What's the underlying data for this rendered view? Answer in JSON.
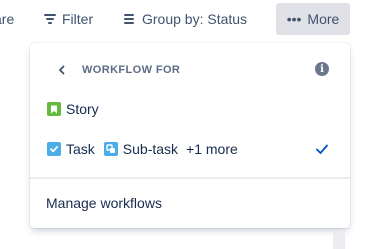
{
  "toolbar": {
    "prev_label": "are",
    "filter_label": "Filter",
    "group_by_label": "Group by: Status",
    "more_label": "More"
  },
  "dropdown": {
    "title": "WORKFLOW FOR",
    "items": [
      {
        "types": [
          "Story"
        ],
        "checked": false
      },
      {
        "types": [
          "Task",
          "Sub-task"
        ],
        "extra": "+1 more",
        "checked": true
      }
    ],
    "manage_label": "Manage workflows"
  },
  "icons": {
    "filter": "filter-icon",
    "group_by": "list-icon",
    "more": "more-dots-icon",
    "back": "chevron-left-icon",
    "info": "info-icon",
    "story": "story-icon",
    "task": "task-icon",
    "subtask": "subtask-icon",
    "check": "check-icon"
  },
  "colors": {
    "story": "#63ba3c",
    "task": "#4bade8",
    "check": "#0052cc",
    "more_button_bg": "#dfe1e6"
  }
}
